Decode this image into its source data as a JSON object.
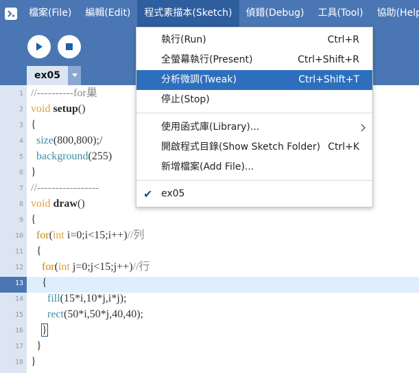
{
  "menubar": {
    "items": [
      {
        "label": "檔案(File)"
      },
      {
        "label": "編輯(Edit)"
      },
      {
        "label": "程式素描本(Sketch)"
      },
      {
        "label": "偵錯(Debug)"
      },
      {
        "label": "工具(Tool)"
      },
      {
        "label": "協助(Help)"
      }
    ],
    "active_index": 2
  },
  "toolbar": {
    "run_icon": "play-icon",
    "stop_icon": "stop-icon"
  },
  "tabs": [
    {
      "label": "ex05"
    }
  ],
  "sketch_menu": {
    "items": [
      {
        "label": "執行(Run)",
        "shortcut": "Ctrl+R"
      },
      {
        "label": "全螢幕執行(Present)",
        "shortcut": "Ctrl+Shift+R"
      },
      {
        "label": "分析微調(Tweak)",
        "shortcut": "Ctrl+Shift+T"
      },
      {
        "label": "停止(Stop)",
        "shortcut": ""
      },
      {
        "label": "使用函式庫(Library)...",
        "shortcut": ""
      },
      {
        "label": "開啟程式目錄(Show Sketch Folder)",
        "shortcut": "Ctrl+K"
      },
      {
        "label": "新增檔案(Add File)...",
        "shortcut": ""
      },
      {
        "label": "ex05",
        "shortcut": ""
      }
    ],
    "highlight_index": 2
  },
  "editor": {
    "current_line": 13,
    "line_numbers": [
      "1",
      "2",
      "3",
      "4",
      "5",
      "6",
      "7",
      "8",
      "9",
      "10",
      "11",
      "12",
      "13",
      "14",
      "15",
      "16",
      "17",
      "18"
    ],
    "code": {
      "l1_comment": "//----------for巢",
      "l2_kw": "void",
      "l2_fn": "setup",
      "l2_rest": "()",
      "l3": "{",
      "l4_fn": "size",
      "l4_rest": "(800,800);/",
      "l5_fn": "background",
      "l5_rest": "(255)",
      "l6": "}",
      "l7_comment": "//-----------------",
      "l8_kw": "void",
      "l8_fn": "draw",
      "l8_rest": "()",
      "l9": "{",
      "l10_kw": "for",
      "l10_p": "(",
      "l10_ty": "int",
      "l10_rest": " i=0;i<15;i++)",
      "l10_comment": "//列",
      "l11": "{",
      "l12_kw": "for",
      "l12_p": "(",
      "l12_ty": "int",
      "l12_rest": " j=0;j<15;j++)",
      "l12_comment": "//行",
      "l13": "{",
      "l14_fn": "fill",
      "l14_rest": "(15*i,10*j,i*j);",
      "l15_fn": "rect",
      "l15_rest": "(50*i,50*j,40,40);",
      "l16": "}",
      "l17": "}",
      "l18": "}"
    }
  },
  "colors": {
    "menubar_bg": "#4a76b4",
    "menu_active_bg": "#2e5e9e",
    "menu_highlight_bg": "#2e6fbd",
    "gutter_bg": "#dce6f2",
    "current_line_bg": "#dfeefc"
  }
}
